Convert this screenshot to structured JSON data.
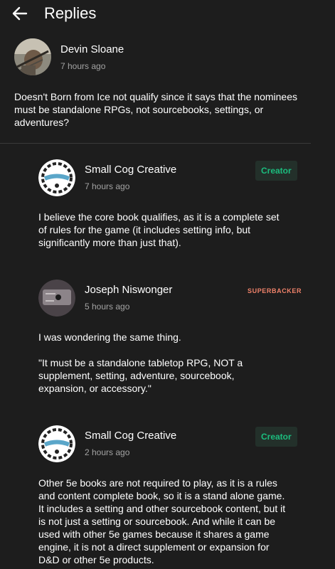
{
  "header": {
    "title": "Replies",
    "back_icon": "arrow-left-icon"
  },
  "comment": {
    "author": "Devin Sloane",
    "time": "7 hours ago",
    "text": "Doesn't Born from Ice not qualify since it says that the nominees must be standalone RPGs, not sourcebooks, settings, or adventures?"
  },
  "replies": [
    {
      "author": "Small Cog Creative",
      "badge": "Creator",
      "time": "7 hours ago",
      "text": "I believe the core book qualifies, as it is a complete set of rules for the game (it includes setting info, but significantly more than just that)."
    },
    {
      "author": "Joseph Niswonger",
      "badge": "SUPERBACKER",
      "time": "5 hours ago",
      "text1": "I was wondering the same thing.",
      "text2": "\"It must be a standalone tabletop RPG, NOT a supplement, setting, adventure, sourcebook, expansion, or accessory.\""
    },
    {
      "author": "Small Cog Creative",
      "badge": "Creator",
      "time": "2 hours ago",
      "text": "Other 5e books are not required to play, as it is a rules and content complete book, so it is a stand alone game. It includes a setting and other sourcebook content, but it is not just a setting or sourcebook. And while it can be used with other 5e games because it shares a game engine, it is not a direct supplement or expansion for D&D or other 5e products."
    }
  ],
  "colors": {
    "background": "#1d1d1d",
    "creator_green": "#1bbd7e",
    "superbacker": "#f0826a",
    "muted": "#a3a3a3"
  }
}
